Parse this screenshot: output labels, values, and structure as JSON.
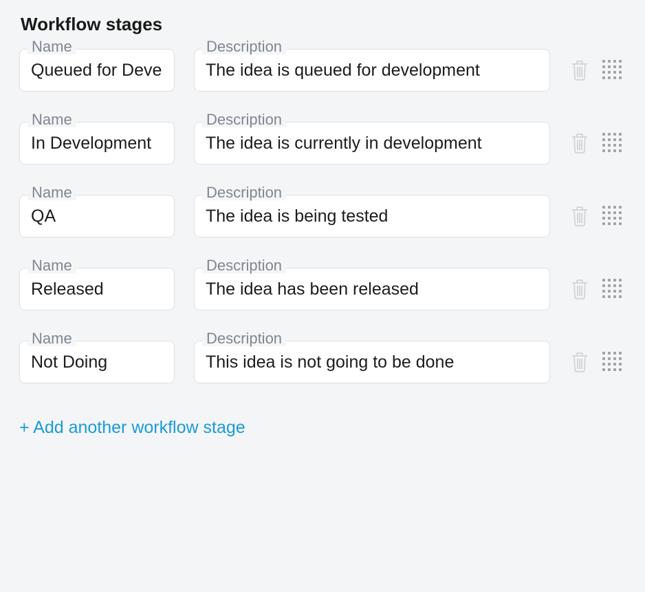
{
  "section": {
    "title": "Workflow stages"
  },
  "labels": {
    "name": "Name",
    "description": "Description"
  },
  "stages": [
    {
      "name": "Queued for Development",
      "description": "The idea is queued for development"
    },
    {
      "name": "In Development",
      "description": "The idea is currently in development"
    },
    {
      "name": "QA",
      "description": "The idea is being tested"
    },
    {
      "name": "Released",
      "description": "The idea has been released"
    },
    {
      "name": "Not Doing",
      "description": "This idea is not going to be done"
    }
  ],
  "add_link": "+ Add another workflow stage"
}
